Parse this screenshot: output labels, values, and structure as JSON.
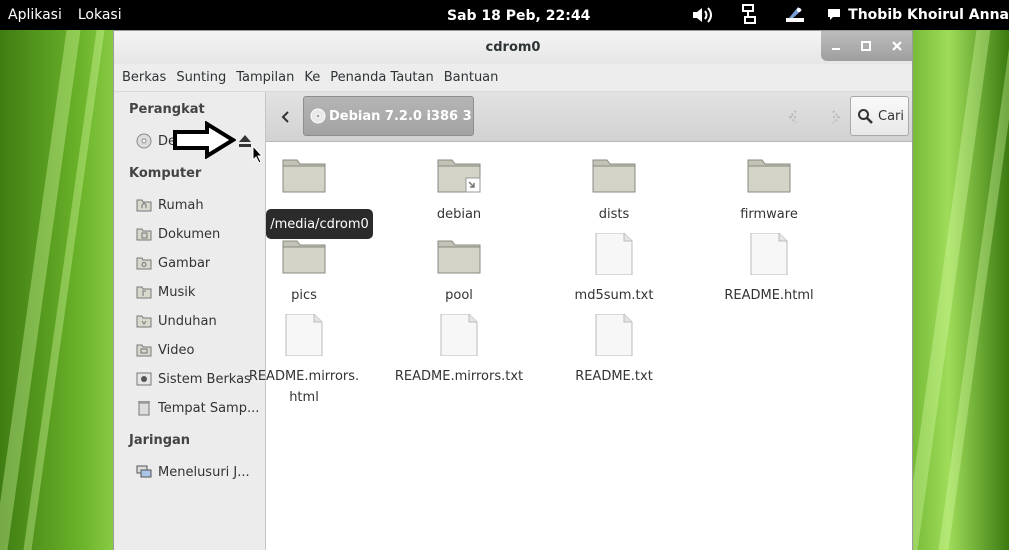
{
  "top_panel": {
    "menus": [
      "Aplikasi",
      "Lokasi"
    ],
    "clock": "Sab 18 Peb, 22:44",
    "user": "Thobib Khoirul Anna",
    "tray_icons": [
      "volume-icon",
      "network-icon",
      "tools-icon",
      "chat-icon"
    ]
  },
  "window": {
    "title": "cdrom0",
    "controls": [
      "minimize",
      "maximize",
      "close"
    ],
    "menubar": [
      "Berkas",
      "Sunting",
      "Tampilan",
      "Ke",
      "Penanda Tautan",
      "Bantuan"
    ]
  },
  "sidebar": {
    "devices_heading": "Perangkat",
    "device": "Debian 7",
    "computer_heading": "Komputer",
    "computer_items": [
      "Rumah",
      "Dokumen",
      "Gambar",
      "Musik",
      "Unduhan",
      "Video",
      "Sistem Berkas",
      "Tempat Samp..."
    ],
    "network_heading": "Jaringan",
    "network_item": "Menelusuri J..."
  },
  "toolbar": {
    "path": "Debian 7.2.0 i386 3",
    "search_label": "Cari"
  },
  "tooltip": "/media/cdrom0",
  "files": [
    {
      "name": "",
      "type": "folder"
    },
    {
      "name": "debian",
      "type": "folder-link"
    },
    {
      "name": "dists",
      "type": "folder"
    },
    {
      "name": "firmware",
      "type": "folder"
    },
    {
      "name": "pics",
      "type": "folder"
    },
    {
      "name": "pool",
      "type": "folder"
    },
    {
      "name": "md5sum.txt",
      "type": "file"
    },
    {
      "name": "README.html",
      "type": "file"
    },
    {
      "name": "README.mirrors.\nhtml",
      "type": "file"
    },
    {
      "name": "README.mirrors.txt",
      "type": "file"
    },
    {
      "name": "README.txt",
      "type": "file"
    }
  ],
  "colors": {
    "panel": "#000000",
    "path_button": "#a8a8a8",
    "folder": "#c9c9bd"
  }
}
